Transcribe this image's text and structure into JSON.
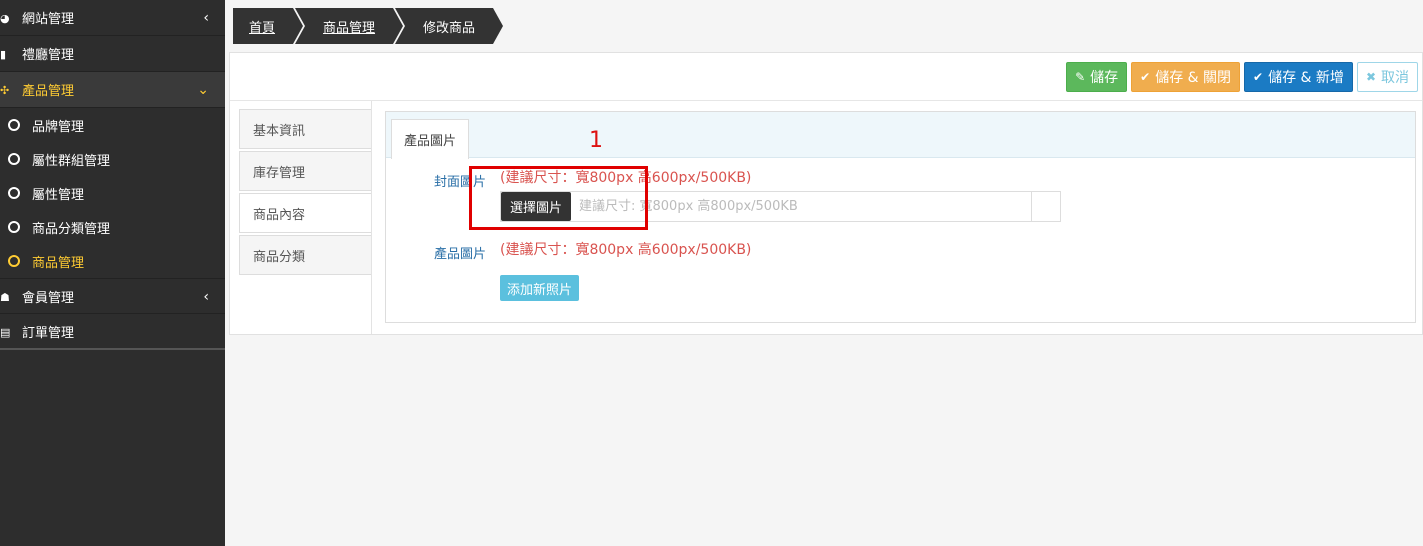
{
  "sidebar": {
    "items": [
      {
        "icon": "globe-icon",
        "glyph": "◕",
        "label": "網站管理",
        "arrow": "‹"
      },
      {
        "icon": "building-icon",
        "glyph": "▮",
        "label": "禮廳管理"
      },
      {
        "icon": "cubes-icon",
        "glyph": "✣",
        "label": "產品管理",
        "arrow": "⌄",
        "active": true
      },
      {
        "icon": "users-icon",
        "glyph": "☗",
        "label": "會員管理",
        "arrow": "‹"
      },
      {
        "icon": "file-icon",
        "glyph": "▤",
        "label": "訂單管理"
      }
    ],
    "sub_items": [
      {
        "label": "品牌管理"
      },
      {
        "label": "屬性群組管理"
      },
      {
        "label": "屬性管理"
      },
      {
        "label": "商品分類管理"
      },
      {
        "label": "商品管理",
        "current": true
      }
    ]
  },
  "breadcrumb": [
    {
      "label": "首頁"
    },
    {
      "label": "商品管理"
    },
    {
      "label": "修改商品"
    }
  ],
  "toolbar": {
    "save": "儲存",
    "save_close": "儲存 & 關閉",
    "save_new": "儲存 & 新增",
    "cancel": "取消"
  },
  "vtabs": [
    "基本資訊",
    "庫存管理",
    "商品內容",
    "商品分類"
  ],
  "content": {
    "tab": "產品圖片",
    "cover_label": "封面圖片",
    "cover_hint": "(建議尺寸：寬800px 高600px/500KB)",
    "choose_button": "選擇圖片",
    "cover_placeholder": "建議尺寸: 寬800px 高800px/500KB",
    "product_label": "產品圖片",
    "product_hint": "(建議尺寸：寬800px 高600px/500KB)",
    "add_photo": "添加新照片"
  },
  "annotation": {
    "number": "1",
    "color": "#e00000"
  },
  "colors": {
    "sidebar_bg": "#2d2d2d",
    "accent": "#ffcc33",
    "save": "#5cb85c",
    "save_close": "#f0ad4e",
    "save_new": "#1b7bc4",
    "hint": "#d9534f"
  }
}
